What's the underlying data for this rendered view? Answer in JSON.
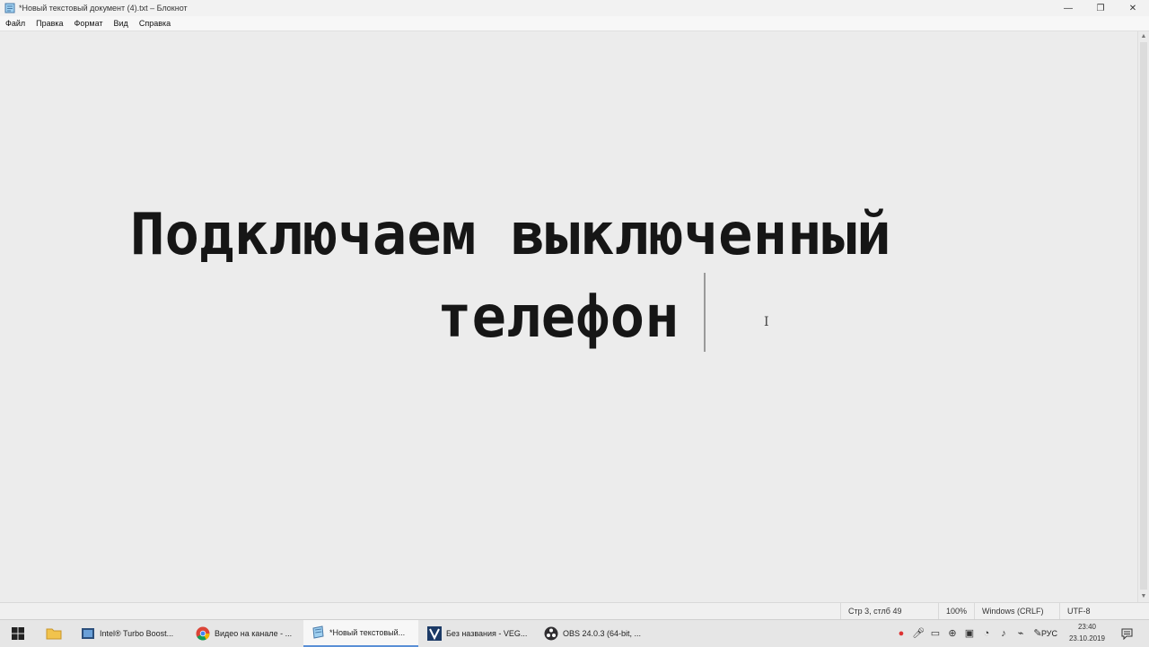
{
  "window": {
    "title": "*Новый текстовый документ (4).txt – Блокнот",
    "minimize_glyph": "—",
    "maximize_glyph": "❐",
    "close_glyph": "✕"
  },
  "menu": {
    "file": "Файл",
    "edit": "Правка",
    "format": "Формат",
    "view": "Вид",
    "help": "Справка"
  },
  "editor": {
    "line1": "Подключаем выключенный",
    "line2": "телефон"
  },
  "statusbar": {
    "position": "Стр 3, стлб 49",
    "zoom": "100%",
    "line_endings": "Windows (CRLF)",
    "encoding": "UTF-8"
  },
  "taskbar": {
    "apps": [
      {
        "label": "Intel® Turbo Boost...",
        "icon": "intel-turbo-boost-icon"
      },
      {
        "label": "Видео на канале - ...",
        "icon": "chrome-icon"
      },
      {
        "label": "*Новый текстовый...",
        "icon": "notepad-icon",
        "active": true
      },
      {
        "label": "Без названия - VEG...",
        "icon": "vegas-icon"
      },
      {
        "label": "OBS 24.0.3 (64-bit, ...",
        "icon": "obs-icon"
      }
    ],
    "language": "РУС",
    "time": "23:40",
    "date": "23.10.2019"
  },
  "colors": {
    "accent": "#5a8fd6",
    "background": "#ececec",
    "text": "#161616"
  }
}
